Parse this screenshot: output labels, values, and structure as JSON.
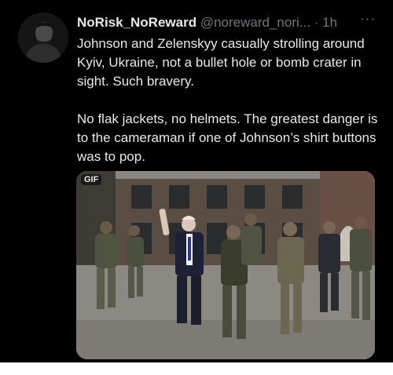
{
  "tweet": {
    "display_name": "NoRisk_NoReward",
    "handle": "@noreward_nori...",
    "separator": "·",
    "time": "1h",
    "more": "···",
    "text": "Johnson and Zelenskyy casually strolling around Kyiv, Ukraine, not a bullet hole or bomb crater in sight. Such bravery.\n\nNo flak jackets, no helmets. The greatest danger is to the cameraman if one of Johnson’s shirt buttons was to pop."
  },
  "media": {
    "badge": "GIF"
  },
  "icons": {
    "avatar": "avatar-silhouette",
    "more": "more-horizontal-icon"
  },
  "colors": {
    "background": "#000000",
    "text": "#e7e9ea",
    "secondary_text": "#71767b"
  }
}
